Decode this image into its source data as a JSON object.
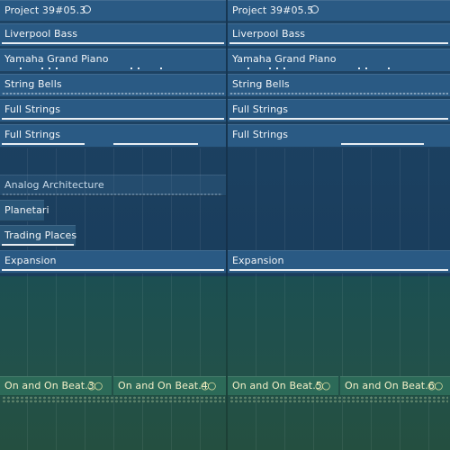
{
  "regions": {
    "project_left": "Project 39#05.3",
    "project_right": "Project 39#05.5",
    "liverpool_left": "Liverpool Bass",
    "liverpool_right": "Liverpool Bass",
    "yamaha_left": "Yamaha Grand Piano",
    "yamaha_right": "Yamaha Grand Piano",
    "bells_left": "String Bells",
    "bells_right": "String Bells",
    "strings1_left": "Full Strings",
    "strings1_right": "Full Strings",
    "strings2_left": "Full Strings",
    "strings2_right": "Full Strings",
    "analog": "Analog Architecture",
    "planetari": "Planetari",
    "trading": "Trading Places",
    "expansion_left": "Expansion",
    "expansion_right": "Expansion",
    "beat3": "On and On Beat.3",
    "beat4": "On and On Beat.4",
    "beat5": "On and On Beat.5",
    "beat6": "On and On Beat.6"
  },
  "icons": {
    "loop": "circle-loop-icon",
    "link": "infinity-link-icon"
  },
  "colors": {
    "track_blue": "#2a5a84",
    "track_green": "#2c6a58",
    "text": "#f1f4f7",
    "green_text": "#f4f0c8"
  }
}
